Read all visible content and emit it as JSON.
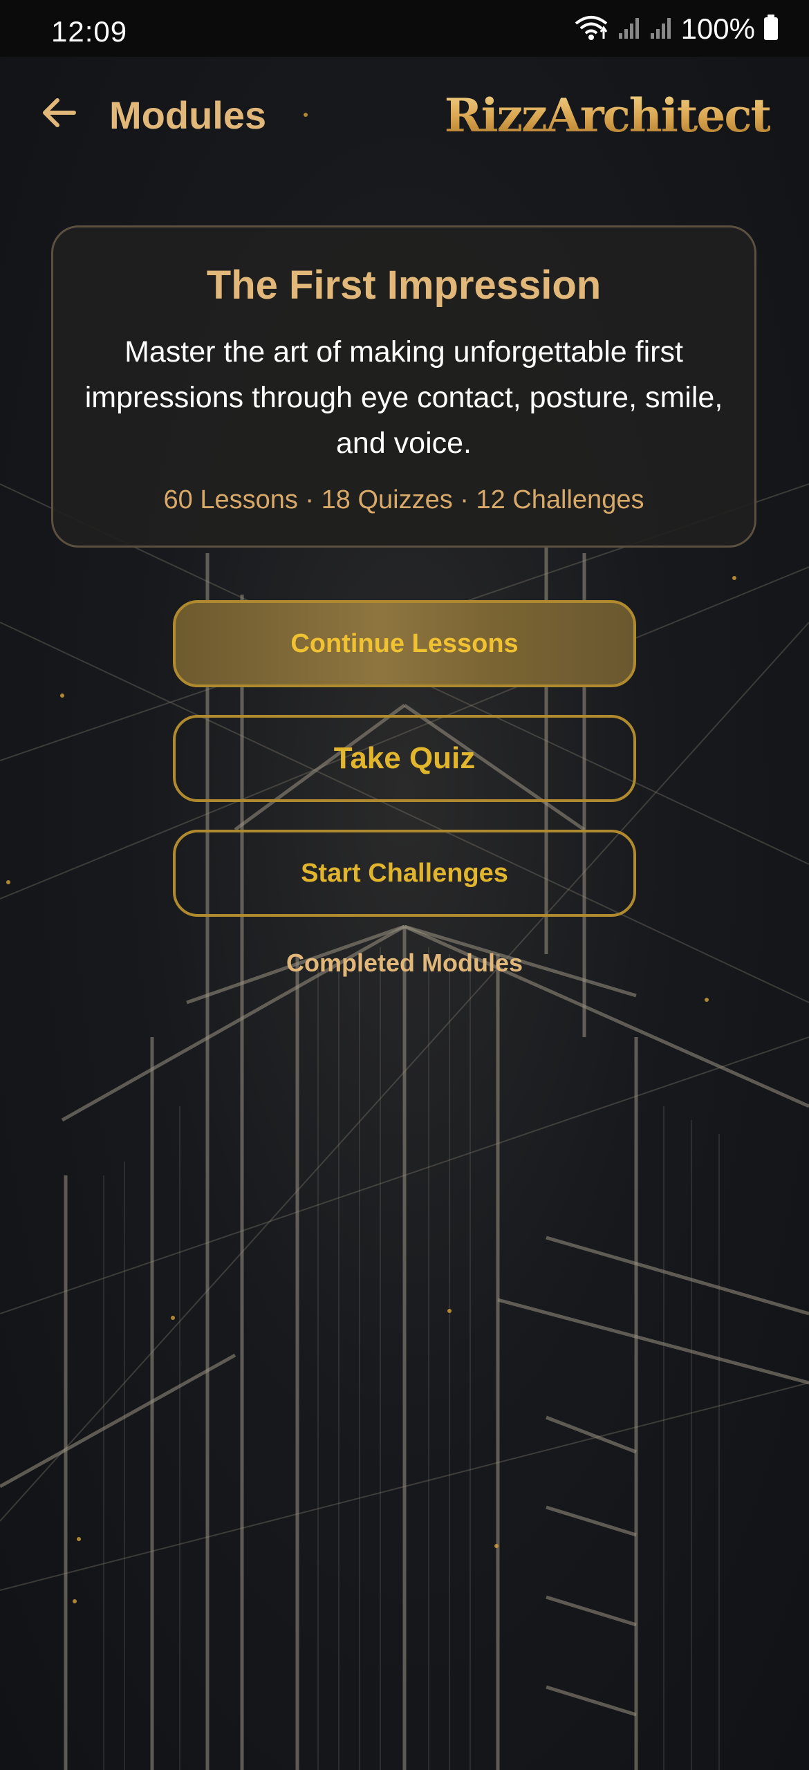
{
  "status_bar": {
    "time": "12:09",
    "battery_text": "100%",
    "icons": [
      "wifi-icon",
      "signal-icon",
      "signal-icon",
      "battery-icon"
    ]
  },
  "app_bar": {
    "title": "Modules",
    "brand": "RizzArchitect",
    "back_icon": "arrow-left-icon"
  },
  "module_card": {
    "title": "The First Impression",
    "description": "Master the art of making unforgettable first impressions through eye contact, posture, smile, and voice.",
    "stats": "60 Lessons · 18 Quizzes · 12 Challenges"
  },
  "actions": {
    "continue_label": "Continue Lessons",
    "quiz_label": "Take Quiz",
    "challenges_label": "Start Challenges",
    "completed_label": "Completed Modules"
  },
  "colors": {
    "accent_gold": "#e2b77a",
    "button_gold": "#e2b52e",
    "background": "#14161a"
  }
}
